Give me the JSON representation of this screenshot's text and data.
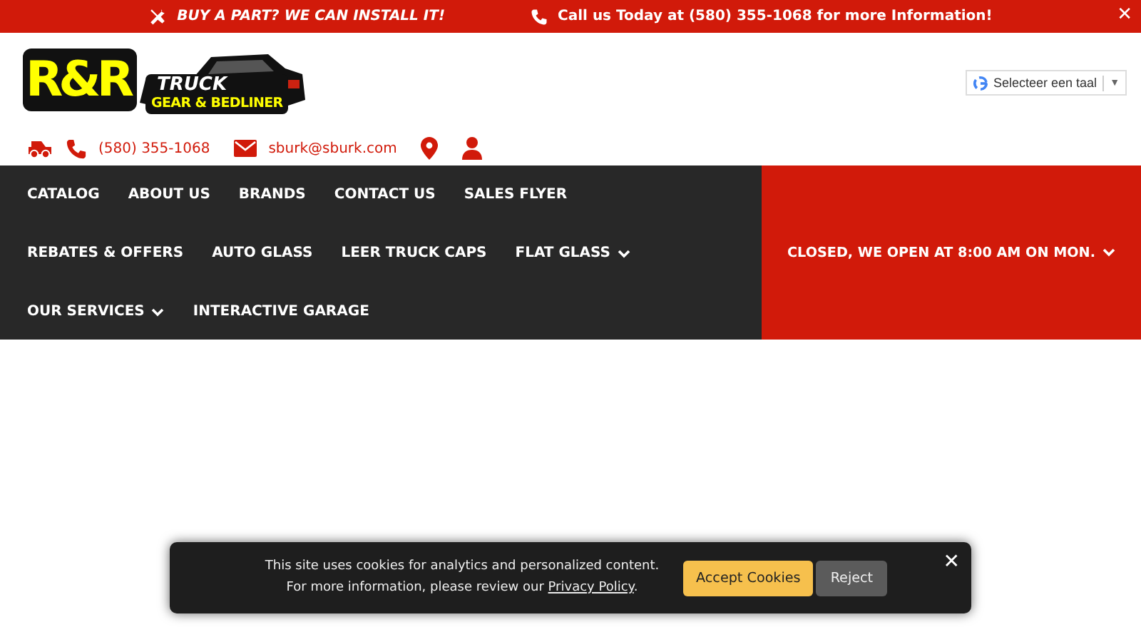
{
  "top_bar": {
    "promo": "BUY A PART? WE CAN INSTALL IT!",
    "call": "Call us Today at (580) 355-1068 for more Information!",
    "close": "✕"
  },
  "logo": {
    "big": "R&R",
    "line_1": "TRUCK",
    "line_2": "GEAR & BEDLINER"
  },
  "translate": {
    "label": "Selecteer een taal",
    "arrow": "▼"
  },
  "contact": {
    "phone": "(580) 355-1068",
    "email": "sburk@sburk.com"
  },
  "nav": [
    {
      "label": "CATALOG",
      "has_dropdown": false
    },
    {
      "label": "ABOUT US",
      "has_dropdown": false
    },
    {
      "label": "BRANDS",
      "has_dropdown": false
    },
    {
      "label": "CONTACT US",
      "has_dropdown": false
    },
    {
      "label": "SALES FLYER",
      "has_dropdown": false
    },
    {
      "label": "REBATES & OFFERS",
      "has_dropdown": false
    },
    {
      "label": "AUTO GLASS",
      "has_dropdown": false
    },
    {
      "label": "LEER TRUCK CAPS",
      "has_dropdown": false
    },
    {
      "label": "FLAT GLASS",
      "has_dropdown": true
    },
    {
      "label": "OUR SERVICES",
      "has_dropdown": true
    },
    {
      "label": "INTERACTIVE GARAGE",
      "has_dropdown": false
    }
  ],
  "hours": {
    "label": "CLOSED, WE OPEN AT 8:00 AM ON MON.",
    "has_dropdown": true
  },
  "cookie": {
    "line_1": "This site uses cookies for analytics and personalized content.",
    "line_2_before": "For more information, please review our ",
    "link": "Privacy Policy",
    "line_2_after": ".",
    "accept": "Accept Cookies",
    "reject": "Reject",
    "close": "✕"
  }
}
